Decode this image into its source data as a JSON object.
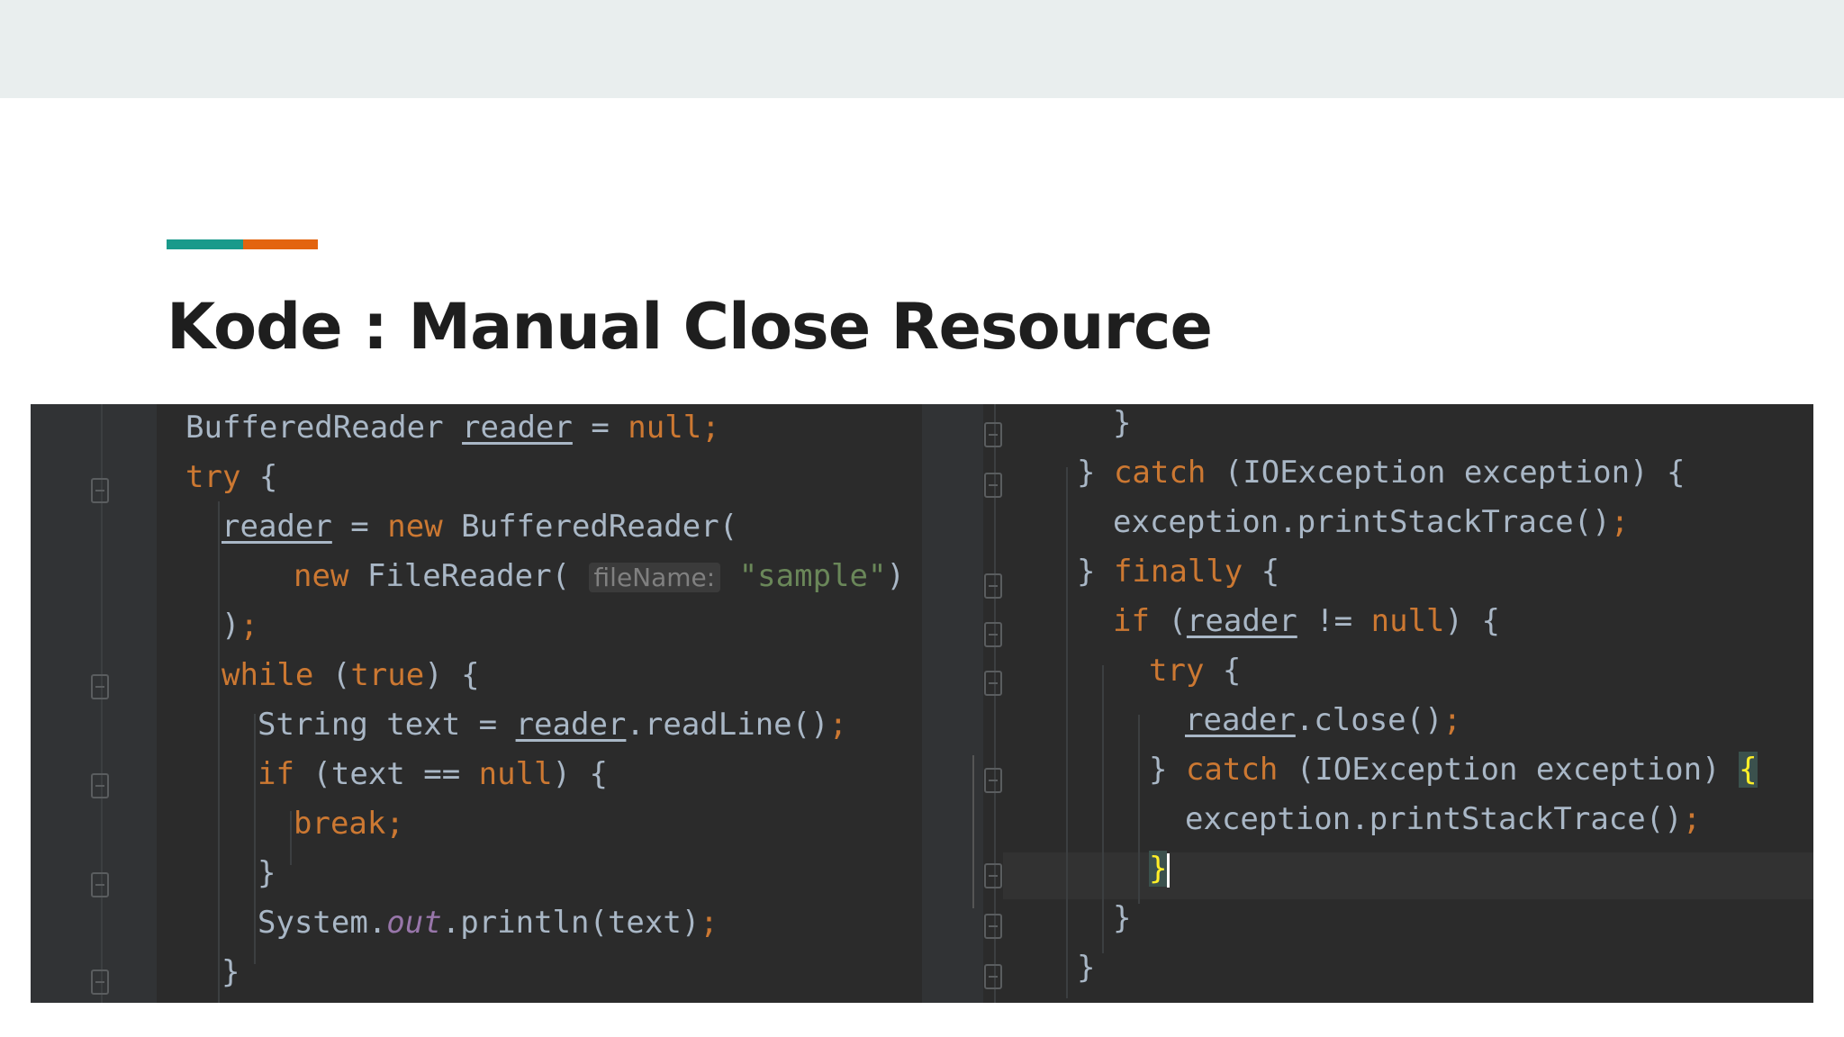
{
  "slide": {
    "title": "Kode : Manual Close Resource",
    "colors": {
      "accent_teal": "#1a9a8b",
      "accent_orange": "#e3640f",
      "code_bg": "#2b2b2b"
    }
  },
  "code_left": {
    "l1": {
      "a": "BufferedReader ",
      "b": "reader",
      "c": " = ",
      "d": "null;"
    },
    "l2": {
      "a": "try",
      "b": " {"
    },
    "l3": {
      "a": "reader",
      "b": " = ",
      "c": "new",
      "d": " BufferedReader("
    },
    "l4": {
      "a": "new",
      "b": " FileReader( ",
      "hint": "fileName:",
      "c": " ",
      "d": "\"sample\"",
      "e": ")"
    },
    "l5": {
      "a": ")",
      "b": ";"
    },
    "l6": {
      "a": "while",
      "b": " (",
      "c": "true",
      "d": ") {"
    },
    "l7": {
      "a": "String text = ",
      "b": "reader",
      "c": ".readLine()",
      "d": ";"
    },
    "l8": {
      "a": "if",
      "b": " (text == ",
      "c": "null",
      "d": ") {"
    },
    "l9": {
      "a": "break;"
    },
    "l10": {
      "a": "}"
    },
    "l11": {
      "a": "System.",
      "b": "out",
      "c": ".println(text)",
      "d": ";"
    },
    "l12": {
      "a": "}"
    }
  },
  "code_right": {
    "l1": {
      "a": "}"
    },
    "l2": {
      "a": "} ",
      "b": "catch",
      "c": " (IOException exception) {"
    },
    "l3": {
      "a": "exception.printStackTrace()",
      "b": ";"
    },
    "l4": {
      "a": "} ",
      "b": "finally",
      "c": " {"
    },
    "l5": {
      "a": "if",
      "b": " (",
      "c": "reader",
      "d": " != ",
      "e": "null",
      "f": ") {"
    },
    "l6": {
      "a": "try",
      "b": " {"
    },
    "l7": {
      "a": "reader",
      "b": ".close()",
      "c": ";"
    },
    "l8": {
      "a": "} ",
      "b": "catch",
      "c": " (IOException exception) ",
      "d": "{"
    },
    "l9": {
      "a": "exception.printStackTrace()",
      "b": ";"
    },
    "l10": {
      "a": "}"
    },
    "l11": {
      "a": "}"
    },
    "l12": {
      "a": "}"
    }
  }
}
